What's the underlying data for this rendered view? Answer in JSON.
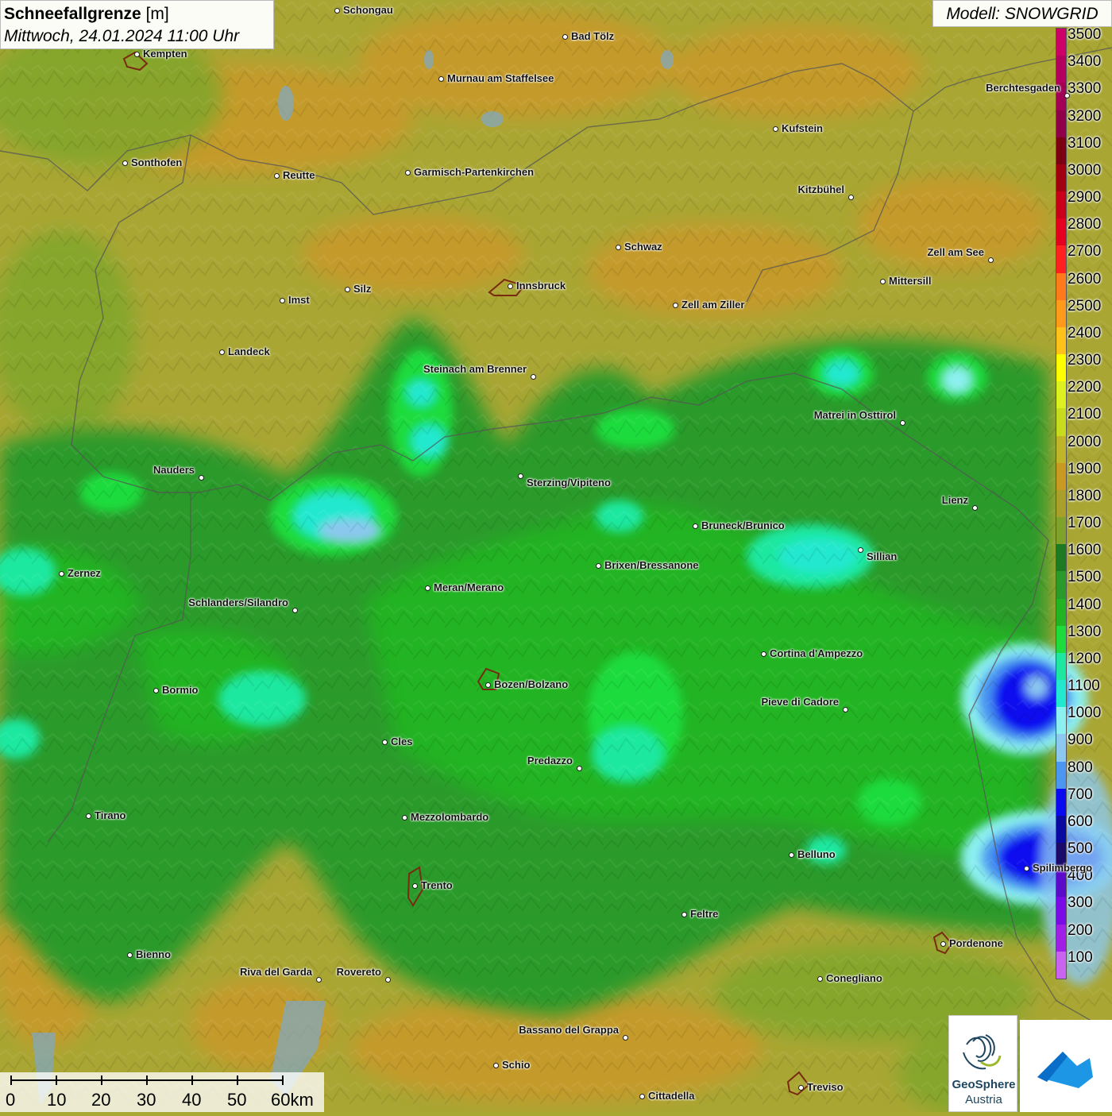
{
  "title": {
    "main": "Schneefallgrenze",
    "unit": "[m]",
    "datetime": "Mittwoch, 24.01.2024 11:00 Uhr"
  },
  "model": "Modell: SNOWGRID",
  "legend": [
    {
      "label": "3500",
      "color": "#cc0066"
    },
    {
      "label": "3400",
      "color": "#b3005f"
    },
    {
      "label": "3300",
      "color": "#a30055"
    },
    {
      "label": "3200",
      "color": "#8e0048"
    },
    {
      "label": "3100",
      "color": "#7a0012"
    },
    {
      "label": "3000",
      "color": "#a00010"
    },
    {
      "label": "2900",
      "color": "#c8001a"
    },
    {
      "label": "2800",
      "color": "#e60020"
    },
    {
      "label": "2700",
      "color": "#ff2020"
    },
    {
      "label": "2600",
      "color": "#ff7a1a"
    },
    {
      "label": "2500",
      "color": "#ff9a1a"
    },
    {
      "label": "2400",
      "color": "#ffc21a"
    },
    {
      "label": "2300",
      "color": "#ffff00"
    },
    {
      "label": "2200",
      "color": "#ddf020"
    },
    {
      "label": "2100",
      "color": "#c8dc1e"
    },
    {
      "label": "2000",
      "color": "#c0b428"
    },
    {
      "label": "1900",
      "color": "#c89a22"
    },
    {
      "label": "1800",
      "color": "#a8a02a"
    },
    {
      "label": "1700",
      "color": "#7ea22a"
    },
    {
      "label": "1600",
      "color": "#1e7a22"
    },
    {
      "label": "1500",
      "color": "#2a9a2a"
    },
    {
      "label": "1400",
      "color": "#22b422"
    },
    {
      "label": "1300",
      "color": "#1edc3c"
    },
    {
      "label": "1200",
      "color": "#1ee8a0"
    },
    {
      "label": "1100",
      "color": "#22e8d0"
    },
    {
      "label": "1000",
      "color": "#8cf0f0"
    },
    {
      "label": "900",
      "color": "#8cc8f0"
    },
    {
      "label": "800",
      "color": "#4a96f0"
    },
    {
      "label": "700",
      "color": "#0a0af0"
    },
    {
      "label": "600",
      "color": "#0a0aa0"
    },
    {
      "label": "500",
      "color": "#1a0a6a"
    },
    {
      "label": "400",
      "color": "#5a0ac8"
    },
    {
      "label": "300",
      "color": "#7a0ae6"
    },
    {
      "label": "200",
      "color": "#a01ee6"
    },
    {
      "label": "100",
      "color": "#c864f0"
    }
  ],
  "cities": [
    {
      "name": "Schongau"
    },
    {
      "name": "Bad Tölz"
    },
    {
      "name": "Kempten"
    },
    {
      "name": "Murnau am Staffelsee"
    },
    {
      "name": "Berchtesgaden"
    },
    {
      "name": "Kufstein"
    },
    {
      "name": "Sonthofen"
    },
    {
      "name": "Reutte"
    },
    {
      "name": "Garmisch-Partenkirchen"
    },
    {
      "name": "Kitzbühel"
    },
    {
      "name": "Schwaz"
    },
    {
      "name": "Zell am See"
    },
    {
      "name": "Innsbruck"
    },
    {
      "name": "Mittersill"
    },
    {
      "name": "Silz"
    },
    {
      "name": "Imst"
    },
    {
      "name": "Zell am Ziller"
    },
    {
      "name": "Landeck"
    },
    {
      "name": "Steinach am Brenner"
    },
    {
      "name": "Matrei in Osttirol"
    },
    {
      "name": "Nauders"
    },
    {
      "name": "Sterzing/Vipiteno"
    },
    {
      "name": "Lienz"
    },
    {
      "name": "Bruneck/Brunico"
    },
    {
      "name": "Sillian"
    },
    {
      "name": "Zernez"
    },
    {
      "name": "Brixen/Bressanone"
    },
    {
      "name": "Meran/Merano"
    },
    {
      "name": "Schlanders/Silandro"
    },
    {
      "name": "Cortina d'Ampezzo"
    },
    {
      "name": "Bozen/Bolzano"
    },
    {
      "name": "Bormio"
    },
    {
      "name": "Pieve di Cadore"
    },
    {
      "name": "Cles"
    },
    {
      "name": "Predazzo"
    },
    {
      "name": "Tirano"
    },
    {
      "name": "Mezzolombardo"
    },
    {
      "name": "Belluno"
    },
    {
      "name": "Spilimbergo"
    },
    {
      "name": "Trento"
    },
    {
      "name": "Feltre"
    },
    {
      "name": "Pordenone"
    },
    {
      "name": "Bienno"
    },
    {
      "name": "Riva del Garda"
    },
    {
      "name": "Rovereto"
    },
    {
      "name": "Conegliano"
    },
    {
      "name": "Bassano del Grappa"
    },
    {
      "name": "Schio"
    },
    {
      "name": "Treviso"
    },
    {
      "name": "Cittadella"
    }
  ],
  "scale": {
    "labels": [
      "0",
      "10",
      "20",
      "30",
      "40",
      "50",
      "60km"
    ]
  },
  "logos": {
    "geosphere_line1": "GeoSphere",
    "geosphere_line2": "Austria"
  }
}
